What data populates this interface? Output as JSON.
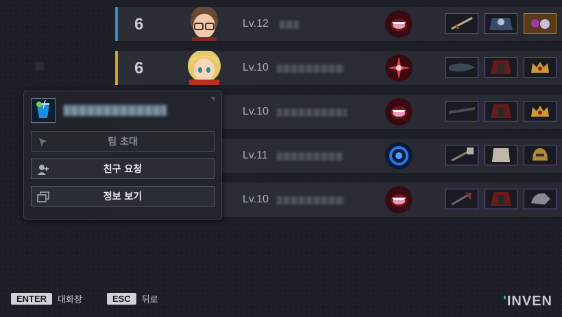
{
  "rows": [
    {
      "num": "6",
      "level": "Lv.12",
      "stripe": "#2f8ec6"
    },
    {
      "num": "6",
      "level": "Lv.10",
      "stripe": "#d6a21e"
    },
    {
      "num": "",
      "level": "Lv.10",
      "stripe": ""
    },
    {
      "num": "",
      "level": "Lv.11",
      "stripe": ""
    },
    {
      "num": "",
      "level": "Lv.10",
      "stripe": ""
    }
  ],
  "popup": {
    "avatar_icon": "cocktail-icon",
    "buttons": [
      {
        "label": "팀 초대",
        "icon": "cursor-icon",
        "enabled": false
      },
      {
        "label": "친구 요청",
        "icon": "add-friend-icon",
        "enabled": true
      },
      {
        "label": "정보 보기",
        "icon": "window-icon",
        "enabled": true
      }
    ]
  },
  "footer": {
    "enter_key": "ENTER",
    "enter_label": "대화창",
    "esc_key": "ESC",
    "esc_label": "뒤로"
  },
  "logo": {
    "dot": "'",
    "text": "INVEN"
  }
}
